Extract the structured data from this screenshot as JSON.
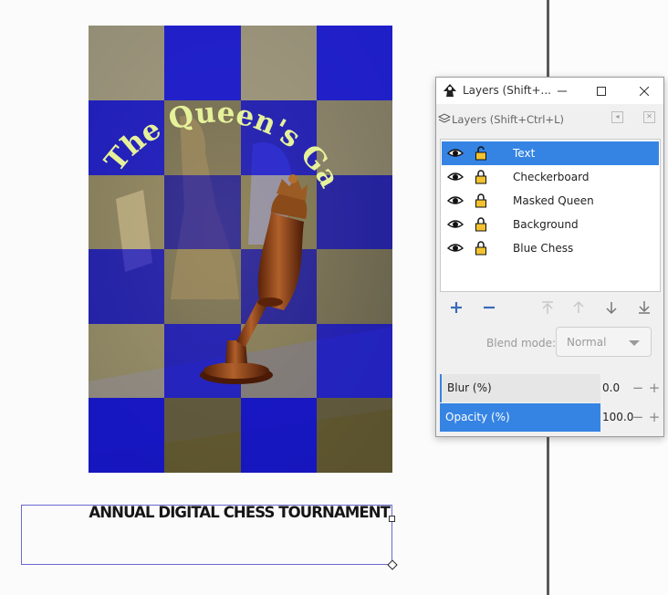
{
  "poster": {
    "title_arc": "The Queen's Gambit",
    "tournament": "ANNUAL DIGITAL CHESS TOURNAMENT"
  },
  "dialog": {
    "window_title": "Layers (Shift+...",
    "panel_title": "Layers (Shift+Ctrl+L)",
    "layers": [
      {
        "label": "Text",
        "visible": true,
        "locked": false,
        "selected": true
      },
      {
        "label": "Checkerboard",
        "visible": true,
        "locked": true,
        "selected": false
      },
      {
        "label": "Masked Queen",
        "visible": true,
        "locked": true,
        "selected": false
      },
      {
        "label": "Background",
        "visible": true,
        "locked": true,
        "selected": false
      },
      {
        "label": "Blue Chess",
        "visible": true,
        "locked": true,
        "selected": false
      }
    ],
    "blend_mode_label": "Blend mode:",
    "blend_mode_value": "Normal",
    "blur": {
      "label": "Blur (%)",
      "value": "0.0"
    },
    "opacity": {
      "label": "Opacity (%)",
      "value": "100.0"
    }
  },
  "colors": {
    "accent": "#3584e4",
    "board_blue": "#1f1fd6",
    "board_tan": "#b9b39a",
    "title_yellow": "#e6f29a"
  },
  "icons": [
    "inkscape-icon",
    "minimize-icon",
    "maximize-icon",
    "close-icon",
    "layers-icon",
    "eye-icon",
    "lock-icon",
    "unlock-icon",
    "plus-icon",
    "minus-icon",
    "move-top-icon",
    "move-up-icon",
    "move-down-icon",
    "move-bottom-icon"
  ]
}
